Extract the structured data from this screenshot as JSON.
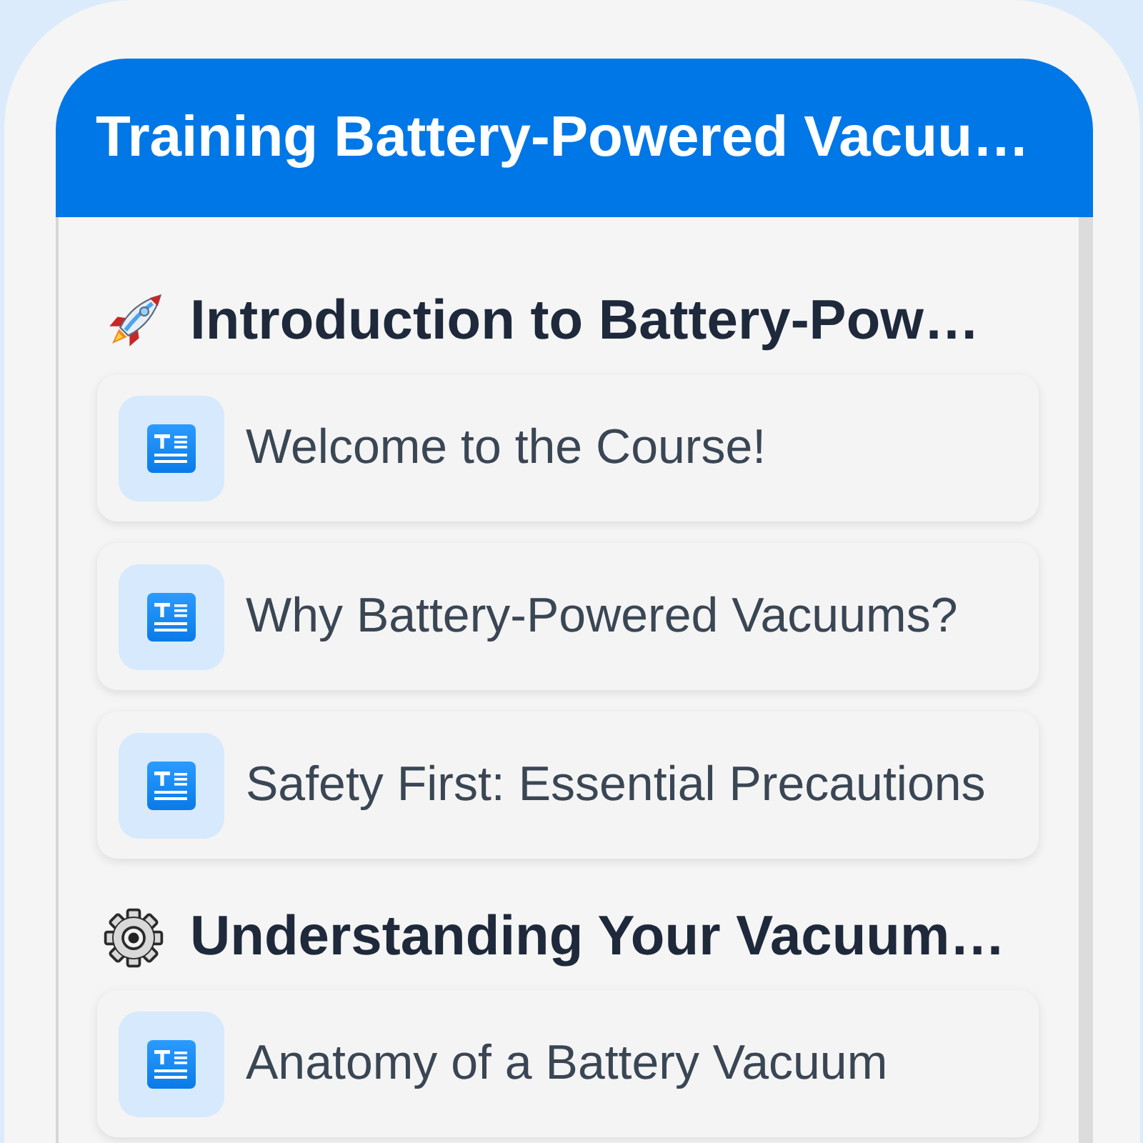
{
  "header": {
    "title": "Training Battery-Powered Vacuu…"
  },
  "sections": [
    {
      "title": "Introduction to Battery-Pow…",
      "lessons": [
        "Welcome to the Course!",
        "Why Battery-Powered Vacuums?",
        "Safety First: Essential Precautions"
      ]
    },
    {
      "title": "Understanding Your Vacuum…",
      "lessons": [
        "Anatomy of a Battery Vacuum"
      ]
    }
  ]
}
